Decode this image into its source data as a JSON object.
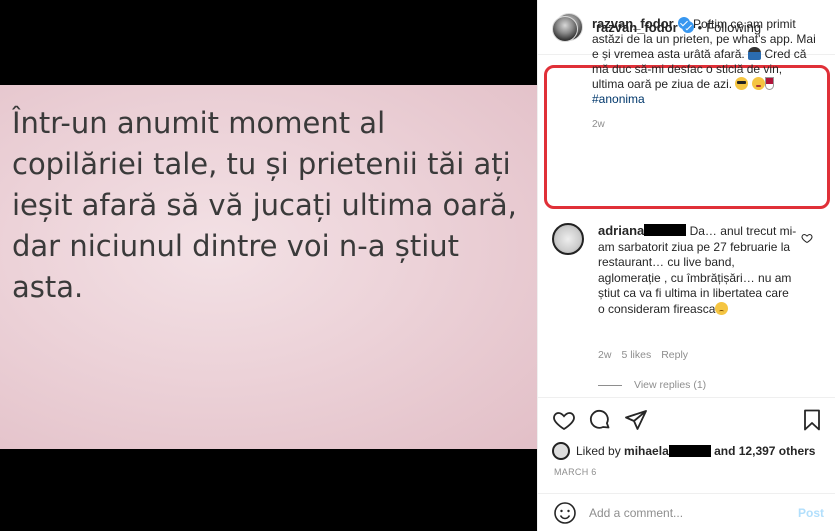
{
  "media": {
    "text": "Într-un anumit moment al\ncopilăriei tale, tu și prietenii tăi ați\nieșit afară să vă jucați ultima oară,\ndar niciunul dintre voi n-a știut\nasta."
  },
  "header": {
    "username": "razvan_fodor",
    "separator": "•",
    "follow_state": "Following"
  },
  "caption": {
    "username": "razvan_fodor",
    "text_1": "Poftim ce am primit astăzi de la un prieten, pe what's app. Mai e și vremea asta urâtă afară.",
    "text_2": "Cred că mă duc să-mi desfac o sticlă de vin, ultima oară pe ziua de azi.",
    "hashtag": "#anonima",
    "age": "2w"
  },
  "comment": {
    "username": "adriana",
    "text": "Da… anul trecut mi-am sarbatorit ziua pe 27 februarie la restaurant… cu live band, aglomerație , cu îmbrățișări… nu am știut ca va fi ultima in libertatea care o consideram fireasca",
    "age": "2w",
    "likes": "5 likes",
    "reply_label": "Reply",
    "view_replies": "View replies (1)"
  },
  "likes": {
    "prefix": "Liked by",
    "user": "mihaela",
    "suffix": "and 12,397 others"
  },
  "date": "MARCH 6",
  "add_comment": {
    "placeholder": "Add a comment...",
    "post_label": "Post"
  },
  "colors": {
    "highlight_border": "#e03038",
    "verified": "#3897f0",
    "post_disabled": "#b2dffc"
  }
}
